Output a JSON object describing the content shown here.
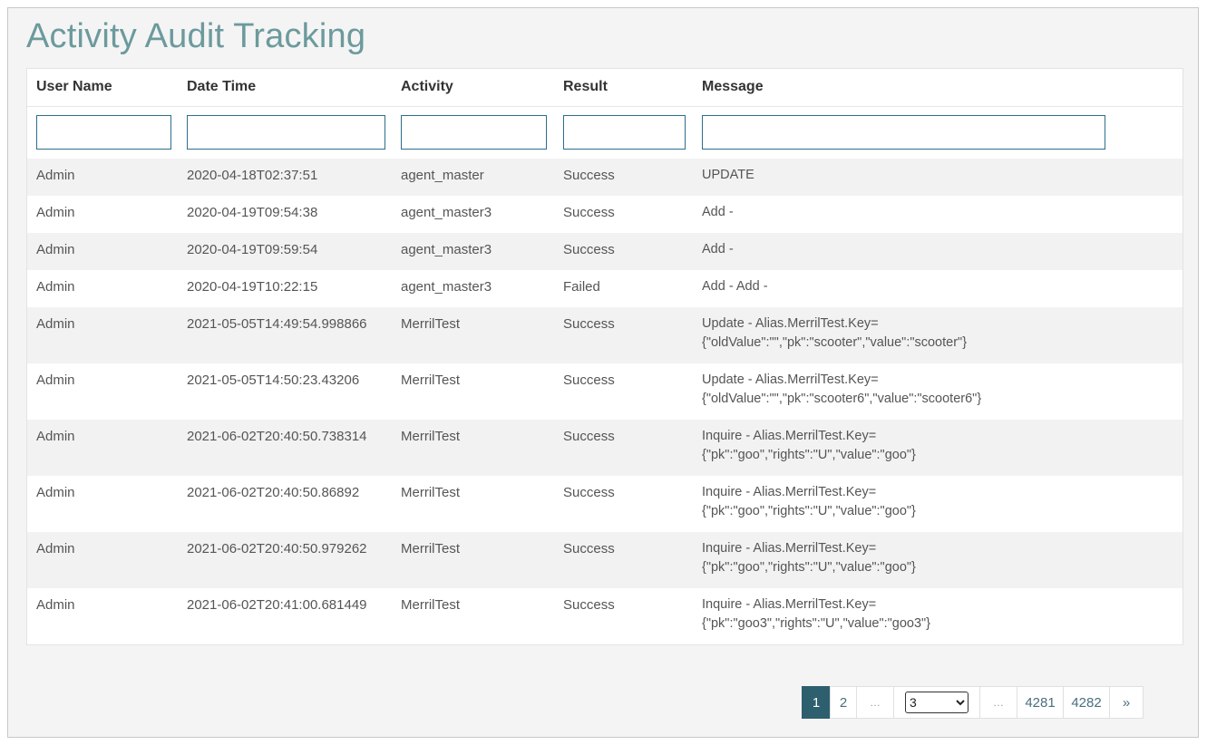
{
  "page": {
    "title": "Activity Audit Tracking"
  },
  "table": {
    "headers": [
      "User Name",
      "Date Time",
      "Activity",
      "Result",
      "Message"
    ],
    "filters": [
      "",
      "",
      "",
      "",
      ""
    ],
    "rows": [
      {
        "user": "Admin",
        "datetime": "2020-04-18T02:37:51",
        "activity": "agent_master",
        "result": "Success",
        "message": [
          "UPDATE"
        ]
      },
      {
        "user": "Admin",
        "datetime": "2020-04-19T09:54:38",
        "activity": "agent_master3",
        "result": "Success",
        "message": [
          "Add -"
        ]
      },
      {
        "user": "Admin",
        "datetime": "2020-04-19T09:59:54",
        "activity": "agent_master3",
        "result": "Success",
        "message": [
          "Add -"
        ]
      },
      {
        "user": "Admin",
        "datetime": "2020-04-19T10:22:15",
        "activity": "agent_master3",
        "result": "Failed",
        "message": [
          "Add - Add -"
        ]
      },
      {
        "user": "Admin",
        "datetime": "2021-05-05T14:49:54.998866",
        "activity": "MerrilTest",
        "result": "Success",
        "message": [
          "Update - Alias.MerrilTest.Key=",
          "{\"oldValue\":\"\",\"pk\":\"scooter\",\"value\":\"scooter\"}"
        ]
      },
      {
        "user": "Admin",
        "datetime": "2021-05-05T14:50:23.43206",
        "activity": "MerrilTest",
        "result": "Success",
        "message": [
          "Update - Alias.MerrilTest.Key=",
          "{\"oldValue\":\"\",\"pk\":\"scooter6\",\"value\":\"scooter6\"}"
        ]
      },
      {
        "user": "Admin",
        "datetime": "2021-06-02T20:40:50.738314",
        "activity": "MerrilTest",
        "result": "Success",
        "message": [
          "Inquire - Alias.MerrilTest.Key=",
          "{\"pk\":\"goo\",\"rights\":\"U\",\"value\":\"goo\"}"
        ]
      },
      {
        "user": "Admin",
        "datetime": "2021-06-02T20:40:50.86892",
        "activity": "MerrilTest",
        "result": "Success",
        "message": [
          "Inquire - Alias.MerrilTest.Key=",
          "{\"pk\":\"goo\",\"rights\":\"U\",\"value\":\"goo\"}"
        ]
      },
      {
        "user": "Admin",
        "datetime": "2021-06-02T20:40:50.979262",
        "activity": "MerrilTest",
        "result": "Success",
        "message": [
          "Inquire - Alias.MerrilTest.Key=",
          "{\"pk\":\"goo\",\"rights\":\"U\",\"value\":\"goo\"}"
        ]
      },
      {
        "user": "Admin",
        "datetime": "2021-06-02T20:41:00.681449",
        "activity": "MerrilTest",
        "result": "Success",
        "message": [
          "Inquire - Alias.MerrilTest.Key=",
          "{\"pk\":\"goo3\",\"rights\":\"U\",\"value\":\"goo3\"}"
        ]
      }
    ]
  },
  "pagination": {
    "items": [
      "1",
      "2",
      "…",
      "3",
      "…",
      "4281",
      "4282",
      "»"
    ],
    "active": "1",
    "select_value": "3"
  },
  "colors": {
    "title": "#6c9a9d",
    "active_page": "#2e5f6e",
    "filter_border": "#2e6d8c"
  }
}
